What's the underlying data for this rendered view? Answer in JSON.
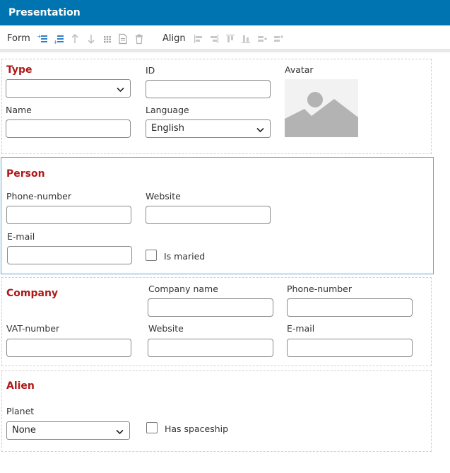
{
  "window": {
    "title": "Presentation"
  },
  "toolbar": {
    "form_label": "Form",
    "align_label": "Align",
    "icons": [
      "add-row-above-icon",
      "add-row-below-icon",
      "move-up-icon",
      "move-down-icon",
      "grid-icon",
      "document-icon",
      "delete-icon",
      "align-left-icon",
      "align-right-icon",
      "align-top-icon",
      "align-bottom-icon",
      "distribute-horizontal-icon",
      "distribute-vertical-icon"
    ]
  },
  "sections": {
    "type": {
      "title": "Type",
      "type_value": "",
      "id_label": "ID",
      "id_value": "",
      "avatar_label": "Avatar",
      "name_label": "Name",
      "name_value": "",
      "language_label": "Language",
      "language_value": "English"
    },
    "person": {
      "title": "Person",
      "phone_label": "Phone-number",
      "phone_value": "",
      "website_label": "Website",
      "website_value": "",
      "email_label": "E-mail",
      "email_value": "",
      "married_label": "Is maried",
      "married_checked": false
    },
    "company": {
      "title": "Company",
      "company_name_label": "Company name",
      "company_name_value": "",
      "phone_label": "Phone-number",
      "phone_value": "",
      "vat_label": "VAT-number",
      "vat_value": "",
      "website_label": "Website",
      "website_value": "",
      "email_label": "E-mail",
      "email_value": ""
    },
    "alien": {
      "title": "Alien",
      "planet_label": "Planet",
      "planet_value": "None",
      "spaceship_label": "Has spaceship",
      "spaceship_checked": false
    }
  },
  "colors": {
    "titlebar": "#0073b1",
    "section_title": "#b01818",
    "selected_border": "#5aa9d6",
    "icon_blue": "#2e7fc6",
    "icon_gray": "#b5b5b5"
  }
}
